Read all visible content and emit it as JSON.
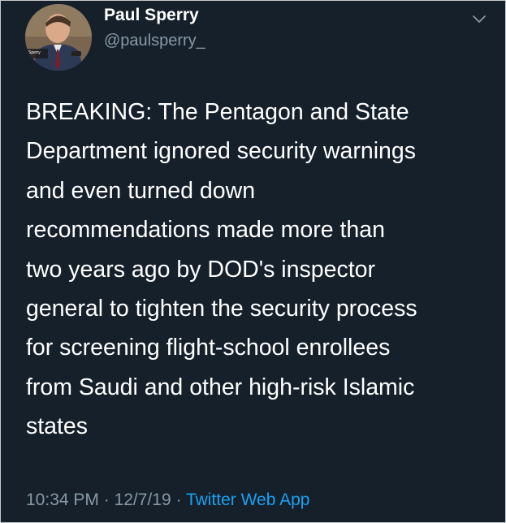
{
  "author": {
    "name": "Paul Sperry",
    "handle": "@paulsperry_",
    "avatar_caption": "Sperry"
  },
  "tweet": {
    "lines": [
      "BREAKING: The Pentagon and State",
      "Department ignored security warnings",
      "and even turned down",
      "recommendations made more than",
      "two years ago by DOD's inspector",
      "general to tighten the security process",
      "for screening flight-school enrollees",
      "from Saudi and other high-risk Islamic",
      "states"
    ]
  },
  "meta": {
    "time": "10:34 PM",
    "separator1": " · ",
    "date": "12/7/19",
    "separator2": " · ",
    "source": "Twitter Web App"
  },
  "icons": {
    "menu": "chevron-down-icon",
    "avatar": "profile-photo"
  },
  "colors": {
    "background": "#15202b",
    "text": "#ffffff",
    "secondary_text": "#8899a6",
    "link": "#1da1f2"
  }
}
